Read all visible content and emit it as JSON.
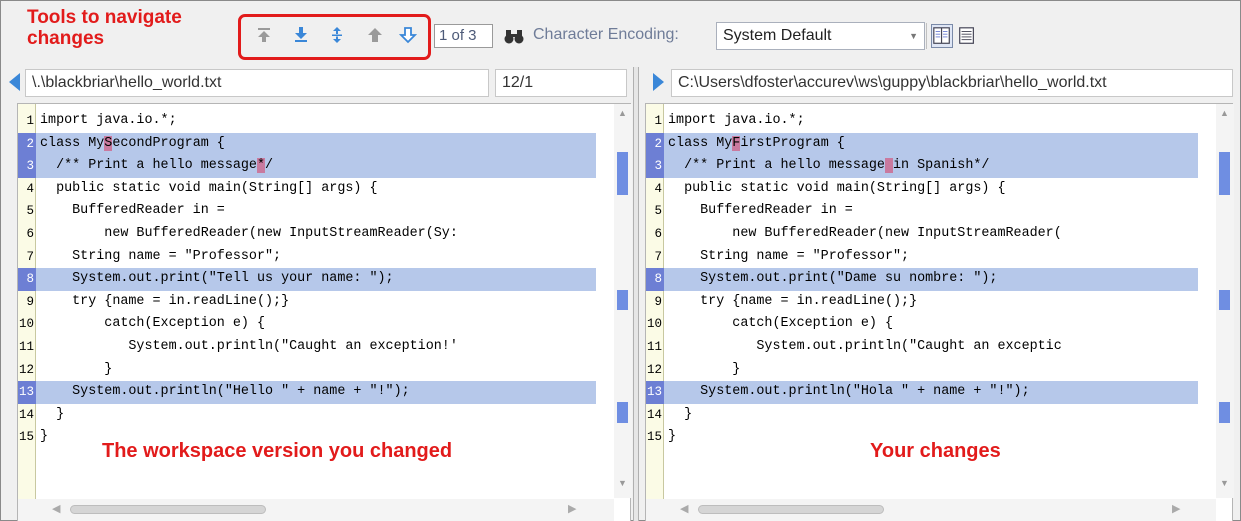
{
  "annotations": {
    "tools": "Tools to navigate changes",
    "left_pane": "The workspace version you changed",
    "right_pane": "Your changes"
  },
  "toolbar": {
    "buttons": [
      "first-change-icon",
      "download-icon",
      "expand-icon",
      "previous-change-icon",
      "next-change-icon"
    ],
    "change_count": "1 of 3",
    "encoding_label": "Character Encoding:",
    "encoding_value": "System Default"
  },
  "left": {
    "path": "\\.\\blackbriar\\hello_world.txt",
    "position": "12/1",
    "lines": [
      {
        "n": "1",
        "pre": "import java.io.*;",
        "hl": "",
        "post": "",
        "chg": false
      },
      {
        "n": "2",
        "pre": "class My",
        "hl": "S",
        "post": "econdProgram {",
        "chg": true
      },
      {
        "n": "3",
        "pre": "  /** Print a hello message",
        "hl": "*",
        "post": "/",
        "chg": true
      },
      {
        "n": "4",
        "pre": "  public static void main(String[] args) {",
        "hl": "",
        "post": "",
        "chg": false
      },
      {
        "n": "5",
        "pre": "    BufferedReader in =",
        "hl": "",
        "post": "",
        "chg": false
      },
      {
        "n": "6",
        "pre": "        new BufferedReader(new InputStreamReader(Sy:",
        "hl": "",
        "post": "",
        "chg": false
      },
      {
        "n": "7",
        "pre": "    String name = \"Professor\";",
        "hl": "",
        "post": "",
        "chg": false
      },
      {
        "n": "8",
        "pre": "    System.out.print(\"Tell us your name: \");",
        "hl": "",
        "post": "",
        "chg": true
      },
      {
        "n": "9",
        "pre": "    try {name = in.readLine();}",
        "hl": "",
        "post": "",
        "chg": false
      },
      {
        "n": "10",
        "pre": "        catch(Exception e) {",
        "hl": "",
        "post": "",
        "chg": false
      },
      {
        "n": "11",
        "pre": "           System.out.println(\"Caught an exception!'",
        "hl": "",
        "post": "",
        "chg": false
      },
      {
        "n": "12",
        "pre": "        }",
        "hl": "",
        "post": "",
        "chg": false
      },
      {
        "n": "13",
        "pre": "    System.out.println(\"Hello \" + name + \"!\");",
        "hl": "",
        "post": "",
        "chg": true
      },
      {
        "n": "14",
        "pre": "  }",
        "hl": "",
        "post": "",
        "chg": false
      },
      {
        "n": "15",
        "pre": "}",
        "hl": "",
        "post": "",
        "chg": false
      }
    ]
  },
  "right": {
    "path": "C:\\Users\\dfoster\\accurev\\ws\\guppy\\blackbriar\\hello_world.txt",
    "lines": [
      {
        "n": "1",
        "pre": "import java.io.*;",
        "hl": "",
        "post": "",
        "chg": false
      },
      {
        "n": "2",
        "pre": "class My",
        "hl": "F",
        "post": "irstProgram {",
        "chg": true
      },
      {
        "n": "3",
        "pre": "  /** Print a hello message",
        "hl": " ",
        "post": "in Spanish*/",
        "chg": true
      },
      {
        "n": "4",
        "pre": "  public static void main(String[] args) {",
        "hl": "",
        "post": "",
        "chg": false
      },
      {
        "n": "5",
        "pre": "    BufferedReader in =",
        "hl": "",
        "post": "",
        "chg": false
      },
      {
        "n": "6",
        "pre": "        new BufferedReader(new InputStreamReader(",
        "hl": "",
        "post": "",
        "chg": false
      },
      {
        "n": "7",
        "pre": "    String name = \"Professor\";",
        "hl": "",
        "post": "",
        "chg": false
      },
      {
        "n": "8",
        "pre": "    System.out.print(\"Dame su nombre: \");",
        "hl": "",
        "post": "",
        "chg": true
      },
      {
        "n": "9",
        "pre": "    try {name = in.readLine();}",
        "hl": "",
        "post": "",
        "chg": false
      },
      {
        "n": "10",
        "pre": "        catch(Exception e) {",
        "hl": "",
        "post": "",
        "chg": false
      },
      {
        "n": "11",
        "pre": "           System.out.println(\"Caught an exceptic",
        "hl": "",
        "post": "",
        "chg": false
      },
      {
        "n": "12",
        "pre": "        }",
        "hl": "",
        "post": "",
        "chg": false
      },
      {
        "n": "13",
        "pre": "    System.out.println(\"Hola \" + name + \"!\");",
        "hl": "",
        "post": "",
        "chg": true
      },
      {
        "n": "14",
        "pre": "  }",
        "hl": "",
        "post": "",
        "chg": false
      },
      {
        "n": "15",
        "pre": "}",
        "hl": "",
        "post": "",
        "chg": false
      }
    ]
  },
  "colors": {
    "change_bg": "#b6c8ea",
    "change_marker": "#6f8ee2",
    "char_diff": "#c97a9f",
    "annotation": "#e21b1b"
  }
}
